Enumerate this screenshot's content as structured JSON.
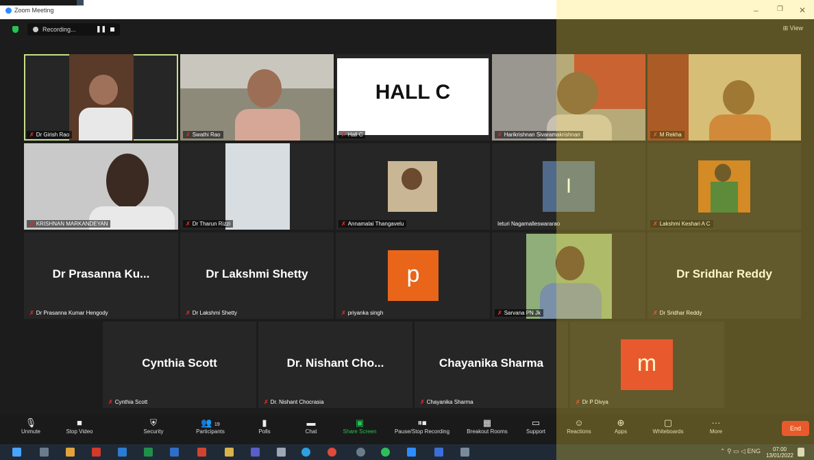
{
  "window": {
    "title": "Zoom Meeting",
    "minimize": "–",
    "maximize": "❐",
    "close": "✕"
  },
  "topbar": {
    "recording_label": "Recording...",
    "pause": "❚❚",
    "view_label": "View"
  },
  "tiles": {
    "t1": {
      "name": "Dr Girish Rao"
    },
    "t2": {
      "name": "Swathi Rao"
    },
    "t3": {
      "name": "Hall C",
      "big": "HALL  C"
    },
    "t4": {
      "name": "Harikrishnan Sivaramakrishnan"
    },
    "t5": {
      "name": "M Rekha"
    },
    "t6": {
      "name": "KRISHNAN MARKANDEYAN"
    },
    "t7": {
      "name": "Dr Tharun Rizzi"
    },
    "t8": {
      "name": "Annamalai Thangavelu"
    },
    "t9": {
      "name": "Ieturi Nagamalleswararao",
      "initial": "I"
    },
    "t10": {
      "name": "Lakshmi Keshari A C"
    },
    "t11": {
      "name": "Dr Prasanna Kumar Hengody",
      "big": "Dr Prasanna Ku..."
    },
    "t12": {
      "name": "Dr Lakshmi Shetty",
      "big": "Dr Lakshmi Shetty"
    },
    "t13": {
      "name": "priyanka singh",
      "initial": "p"
    },
    "t14": {
      "name": "Sarvana PN Jk"
    },
    "t15": {
      "name": "Dr Sridhar Reddy",
      "big": "Dr Sridhar Reddy"
    },
    "t16": {
      "name": "Cynthia Scott",
      "big": "Cynthia Scott"
    },
    "t17": {
      "name": "Dr. Nishant Chocrasia",
      "big": "Dr. Nishant Cho..."
    },
    "t18": {
      "name": "Chayanika Sharma",
      "big": "Chayanika Sharma"
    },
    "t19": {
      "name": "Dr P Divya",
      "initial": "m"
    }
  },
  "toolbar": {
    "unmute": "Unmute",
    "stop_video": "Stop Video",
    "security": "Security",
    "participants": "Participants",
    "participants_count": "19",
    "polls": "Polls",
    "chat": "Chat",
    "share_screen": "Share Screen",
    "pause_recording": "Pause/Stop Recording",
    "breakout": "Breakout Rooms",
    "support": "Support",
    "reactions": "Reactions",
    "apps": "Apps",
    "whiteboards": "Whiteboards",
    "more": "More",
    "end": "End"
  },
  "taskbar": {
    "lang": "ENG",
    "time": "07:00",
    "date": "13/01/2022"
  },
  "colors": {
    "accent_green": "#23c552",
    "end_red": "#e02828",
    "avatar_orange": "#e8651a",
    "avatar_red": "#e02828",
    "active_outline": "#c8e08a"
  }
}
